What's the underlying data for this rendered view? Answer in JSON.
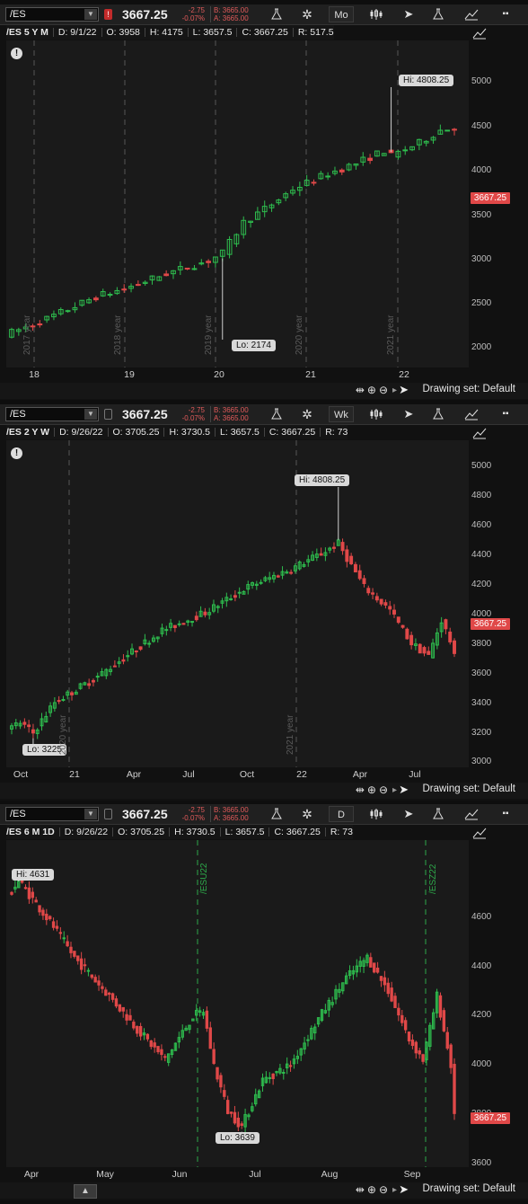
{
  "colors": {
    "up": "#2ebd4e",
    "down": "#e04848",
    "bg": "#1a1a1a",
    "grid": "#555555",
    "event": "#2ea84a"
  },
  "panels": [
    {
      "symbol": "/ES",
      "price": "3667.25",
      "change": "-2.75",
      "change_pct": "-0.07%",
      "bid": "B: 3665.00",
      "ask": "A: 3665.00",
      "period_button": "Mo",
      "info": {
        "title": "/ES 5 Y M",
        "date": "D: 9/1/22",
        "open": "O: 3958",
        "high": "H: 4175",
        "low": "L: 3657.5",
        "close": "C: 3667.25",
        "range": "R: 517.5"
      },
      "hi_label": "Hi: 4808.25",
      "lo_label": "Lo: 2174",
      "last_label": "3667.25",
      "y_ticks": [
        "5000",
        "4500",
        "4000",
        "3500",
        "3000",
        "2500",
        "2000"
      ],
      "x_ticks": [
        "18",
        "19",
        "20",
        "21",
        "22"
      ],
      "year_labels": [
        "2017 year",
        "2018 year",
        "2019 year",
        "2020 year",
        "2021 year"
      ],
      "drawing_set": "Drawing set: Default"
    },
    {
      "symbol": "/ES",
      "price": "3667.25",
      "change": "-2.75",
      "change_pct": "-0.07%",
      "bid": "B: 3665.00",
      "ask": "A: 3665.00",
      "period_button": "Wk",
      "info": {
        "title": "/ES 2 Y W",
        "date": "D: 9/26/22",
        "open": "O: 3705.25",
        "high": "H: 3730.5",
        "low": "L: 3657.5",
        "close": "C: 3667.25",
        "range": "R: 73"
      },
      "hi_label": "Hi: 4808.25",
      "lo_label": "Lo: 3225",
      "last_label": "3667.25",
      "y_ticks": [
        "5000",
        "4800",
        "4600",
        "4400",
        "4200",
        "4000",
        "3800",
        "3600",
        "3400",
        "3200",
        "3000"
      ],
      "x_ticks": [
        "Oct",
        "21",
        "Apr",
        "Jul",
        "Oct",
        "22",
        "Apr",
        "Jul"
      ],
      "year_labels": [
        "2020 year",
        "2021 year"
      ],
      "drawing_set": "Drawing set: Default"
    },
    {
      "symbol": "/ES",
      "price": "3667.25",
      "change": "-2.75",
      "change_pct": "-0.07%",
      "bid": "B: 3665.00",
      "ask": "A: 3665.00",
      "period_button": "D",
      "info": {
        "title": "/ES 6 M 1D",
        "date": "D: 9/26/22",
        "open": "O: 3705.25",
        "high": "H: 3730.5",
        "low": "L: 3657.5",
        "close": "C: 3667.25",
        "range": "R: 73"
      },
      "hi_label": "Hi: 4631",
      "lo_label": "Lo: 3639",
      "last_label": "3667.25",
      "y_ticks": [
        "4600",
        "4400",
        "4200",
        "4000",
        "3800",
        "3600"
      ],
      "x_ticks": [
        "Apr",
        "May",
        "Jun",
        "Jul",
        "Aug",
        "Sep"
      ],
      "event_labels": [
        "/ESU22",
        "/ESZ22"
      ],
      "drawing_set": "Drawing set: Default"
    }
  ],
  "chart_data": [
    {
      "type": "line",
      "title": "/ES 5 Y M",
      "x": [
        "2017-09",
        "2018-01",
        "2018-06",
        "2018-10",
        "2019-01",
        "2019-06",
        "2020-01",
        "2020-03",
        "2020-06",
        "2020-11",
        "2021-01",
        "2021-06",
        "2021-11",
        "2022-01",
        "2022-06",
        "2022-09"
      ],
      "series": [
        {
          "values": [
            2500,
            2780,
            2720,
            2870,
            2500,
            2940,
            3230,
            2174,
            3000,
            3620,
            3800,
            4290,
            4700,
            4808.25,
            3800,
            3667.25
          ]
        }
      ],
      "ylim": [
        1800,
        5200
      ]
    },
    {
      "type": "line",
      "title": "/ES 2 Y W",
      "x": [
        "2020-09",
        "2020-10",
        "2020-11",
        "2021-01",
        "2021-04",
        "2021-07",
        "2021-09",
        "2021-12",
        "2022-01",
        "2022-03",
        "2022-06",
        "2022-08",
        "2022-09"
      ],
      "series": [
        {
          "values": [
            3300,
            3225,
            3550,
            3750,
            4150,
            4400,
            4450,
            4700,
            4808.25,
            4350,
            3700,
            4300,
            3667.25
          ]
        }
      ],
      "ylim": [
        3000,
        5050
      ]
    },
    {
      "type": "line",
      "title": "/ES 6 M 1D",
      "x": [
        "2022-03-29",
        "2022-04-20",
        "2022-05-02",
        "2022-05-20",
        "2022-06-08",
        "2022-06-16",
        "2022-07-01",
        "2022-07-29",
        "2022-08-16",
        "2022-09-02",
        "2022-09-12",
        "2022-09-26"
      ],
      "series": [
        {
          "values": [
            4631,
            4450,
            4150,
            3900,
            4150,
            3639,
            3830,
            4130,
            4320,
            3920,
            4150,
            3667.25
          ]
        }
      ],
      "ylim": [
        3540,
        4760
      ]
    }
  ]
}
